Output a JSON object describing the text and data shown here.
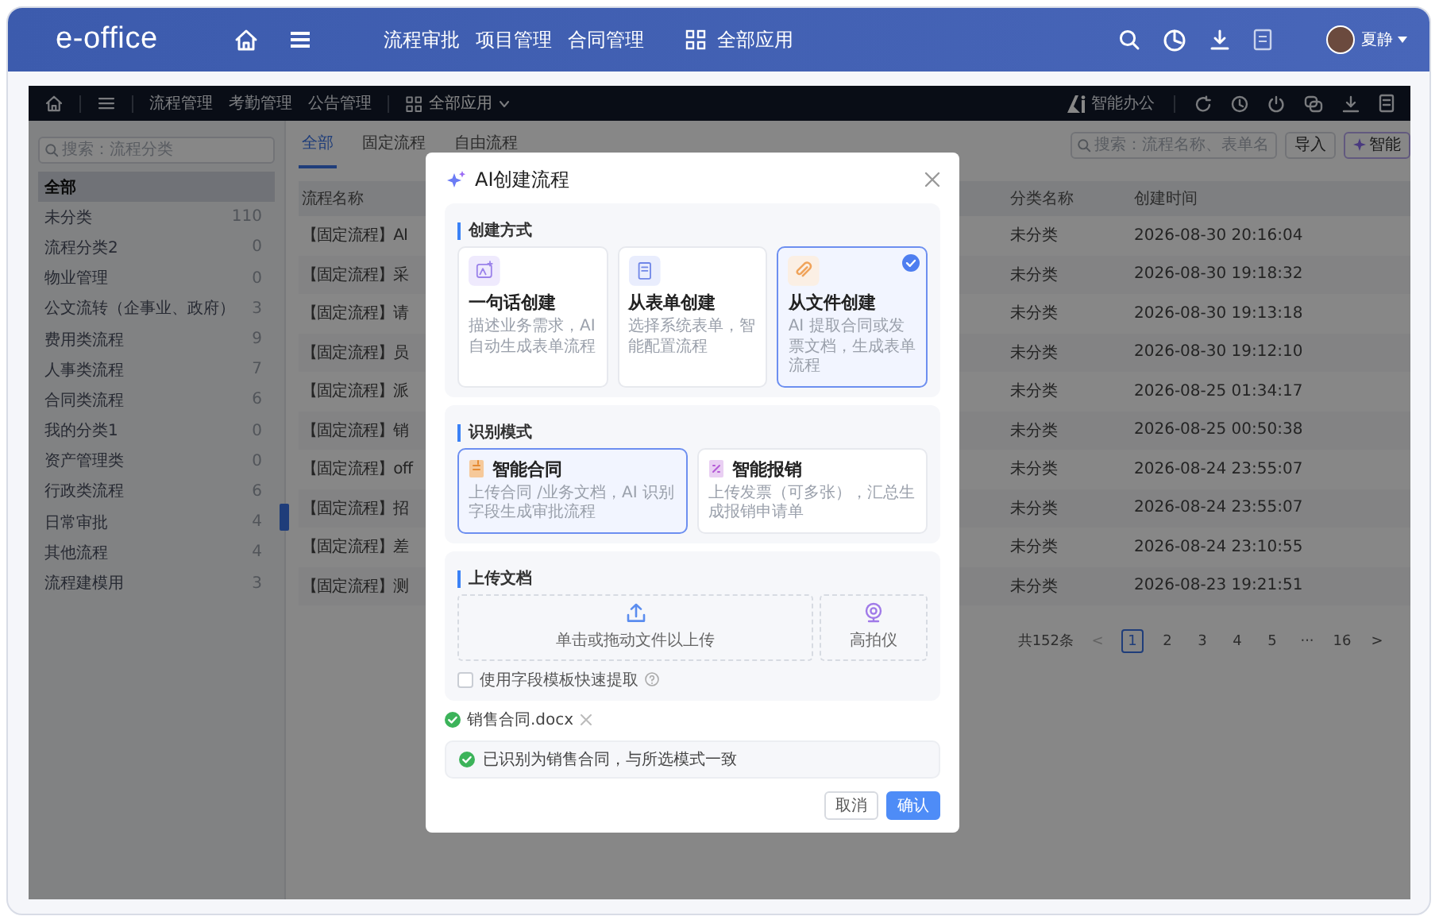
{
  "top_bar": {
    "logo": "e-office",
    "nav": [
      "流程审批",
      "项目管理",
      "合同管理"
    ],
    "all_apps": "全部应用",
    "user": "夏静"
  },
  "app_nav": {
    "links": [
      "流程管理",
      "考勤管理",
      "公告管理"
    ],
    "all_apps": "全部应用",
    "ai_office": "智能办公"
  },
  "sidebar": {
    "search_placeholder": "搜索：流程分类",
    "items": [
      {
        "label": "全部",
        "selected": true
      },
      {
        "label": "未分类",
        "count": "110",
        "selected": false
      },
      {
        "label": "流程分类2",
        "count": "0",
        "selected": false
      },
      {
        "label": "物业管理",
        "count": "0",
        "selected": false
      },
      {
        "label": "公文流转（企事业、政府）",
        "count": "3",
        "selected": false
      },
      {
        "label": "费用类流程",
        "count": "9",
        "selected": false
      },
      {
        "label": "人事类流程",
        "count": "7",
        "selected": false
      },
      {
        "label": "合同类流程",
        "count": "6",
        "selected": false
      },
      {
        "label": "我的分类1",
        "count": "0",
        "selected": false
      },
      {
        "label": "资产管理类",
        "count": "0",
        "selected": false
      },
      {
        "label": "行政类流程",
        "count": "6",
        "selected": false
      },
      {
        "label": "日常审批",
        "count": "4",
        "selected": false
      },
      {
        "label": "其他流程",
        "count": "4",
        "selected": false
      },
      {
        "label": "流程建模用",
        "count": "3",
        "selected": false
      }
    ]
  },
  "tabs": [
    {
      "label": "全部",
      "selected": true
    },
    {
      "label": "固定流程",
      "selected": false
    },
    {
      "label": "自由流程",
      "selected": false
    }
  ],
  "toolbar": {
    "search_placeholder": "搜索：流程名称、表单名",
    "import_button": "导入",
    "ai_button": "智能"
  },
  "table": {
    "columns": [
      "流程名称",
      "分类名称",
      "创建时间"
    ],
    "rows": [
      {
        "name": "【固定流程】AI",
        "category": "未分类",
        "created": "2026-08-30 20:16:04"
      },
      {
        "name": "【固定流程】采",
        "category": "未分类",
        "created": "2026-08-30 19:18:32"
      },
      {
        "name": "【固定流程】请",
        "category": "未分类",
        "created": "2026-08-30 19:13:18"
      },
      {
        "name": "【固定流程】员",
        "category": "未分类",
        "created": "2026-08-30 19:12:10"
      },
      {
        "name": "【固定流程】派",
        "category": "未分类",
        "created": "2026-08-25 01:34:17"
      },
      {
        "name": "【固定流程】销",
        "category": "未分类",
        "created": "2026-08-25 00:50:38"
      },
      {
        "name": "【固定流程】off",
        "category": "未分类",
        "created": "2026-08-24 23:55:07"
      },
      {
        "name": "【固定流程】招",
        "category": "未分类",
        "created": "2026-08-24 23:55:07"
      },
      {
        "name": "【固定流程】差",
        "category": "未分类",
        "created": "2026-08-24 23:10:55"
      },
      {
        "name": "【固定流程】测",
        "category": "未分类",
        "created": "2026-08-23 19:21:51"
      }
    ]
  },
  "pagination": {
    "total": "共152条",
    "prev": "<",
    "next": ">",
    "pages": [
      {
        "label": "1",
        "selected": true
      },
      {
        "label": "2",
        "selected": false
      },
      {
        "label": "3",
        "selected": false
      },
      {
        "label": "4",
        "selected": false
      },
      {
        "label": "5",
        "selected": false
      },
      {
        "label": "···",
        "selected": false
      },
      {
        "label": "16",
        "selected": false
      }
    ]
  },
  "modal": {
    "title": "AI创建流程",
    "create_section": "创建方式",
    "create_methods": [
      {
        "title": "一句话创建",
        "desc": "描述业务需求，AI自动生成表单流程",
        "selected": false
      },
      {
        "title": "从表单创建",
        "desc": "选择系统表单，智能配置流程",
        "selected": false
      },
      {
        "title": "从文件创建",
        "desc": "AI 提取合同或发票文档，生成表单流程",
        "selected": true
      }
    ],
    "mode_section": "识别模式",
    "modes": [
      {
        "title": "智能合同",
        "desc": "上传合同 /业务文档，AI 识别字段生成审批流程",
        "selected": true
      },
      {
        "title": "智能报销",
        "desc": "上传发票（可多张），汇总生成报销申请单",
        "selected": false
      }
    ],
    "upload_section": "上传文档",
    "dropzone": "单击或拖动文件以上传",
    "camera": "高拍仪",
    "template_checkbox": {
      "label": "使用字段模板快速提取",
      "checked": false
    },
    "file": "销售合同.docx",
    "notice": "已识别为销售合同，与所选模式一致",
    "cancel": "取消",
    "confirm": "确认"
  }
}
